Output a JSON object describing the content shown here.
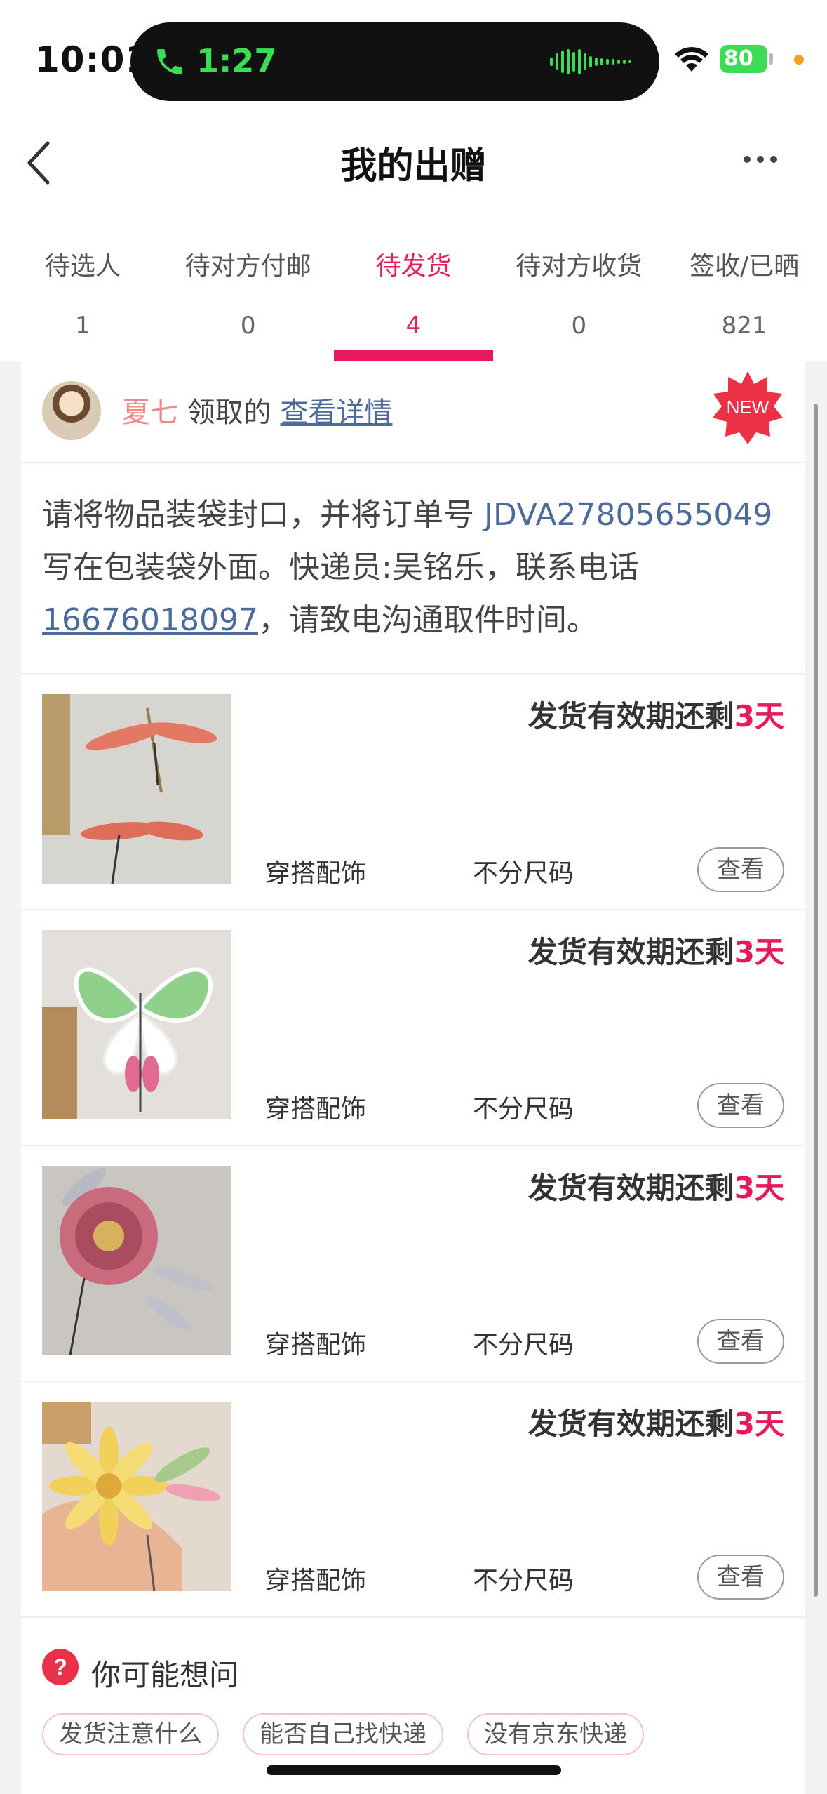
{
  "status_bar": {
    "time": "10:01",
    "call_time": "1:27",
    "battery": "80"
  },
  "nav": {
    "title": "我的出赠"
  },
  "tabs": [
    {
      "label": "待选人",
      "count": "1"
    },
    {
      "label": "待对方付邮",
      "count": "0"
    },
    {
      "label": "待发货",
      "count": "4",
      "active": true
    },
    {
      "label": "待对方收货",
      "count": "0"
    },
    {
      "label": "签收/已晒",
      "count": "821"
    }
  ],
  "claim": {
    "name": "夏七",
    "text": "领取的",
    "link": "查看详情",
    "badge": "NEW"
  },
  "notice": {
    "part1": "请将物品装袋封口，并将订单号 ",
    "order_no": "JDVA27805655049",
    "part2": " 写在包装袋外面。快递员:吴铭乐，联系电话",
    "phone": "16676018097",
    "part3": "，请致电沟通取件时间。"
  },
  "items": [
    {
      "deadline_prefix": "发货有效期还剩",
      "days": "3天",
      "category": "穿搭配饰",
      "size": "不分尺码",
      "button": "查看",
      "image": "dragonfly-hairpin"
    },
    {
      "deadline_prefix": "发货有效期还剩",
      "days": "3天",
      "category": "穿搭配饰",
      "size": "不分尺码",
      "button": "查看",
      "image": "butterfly-hairpin"
    },
    {
      "deadline_prefix": "发货有效期还剩",
      "days": "3天",
      "category": "穿搭配饰",
      "size": "不分尺码",
      "button": "查看",
      "image": "pink-flower-hairpin"
    },
    {
      "deadline_prefix": "发货有效期还剩",
      "days": "3天",
      "category": "穿搭配饰",
      "size": "不分尺码",
      "button": "查看",
      "image": "yellow-chrysanthemum-hairpin"
    }
  ],
  "faq": {
    "title": "你可能想问",
    "chips": [
      "发货注意什么",
      "能否自己找快递",
      "没有京东快递"
    ]
  },
  "colors": {
    "accent": "#e8195a",
    "link": "#4a6b9b",
    "call_green": "#3ddc55"
  }
}
